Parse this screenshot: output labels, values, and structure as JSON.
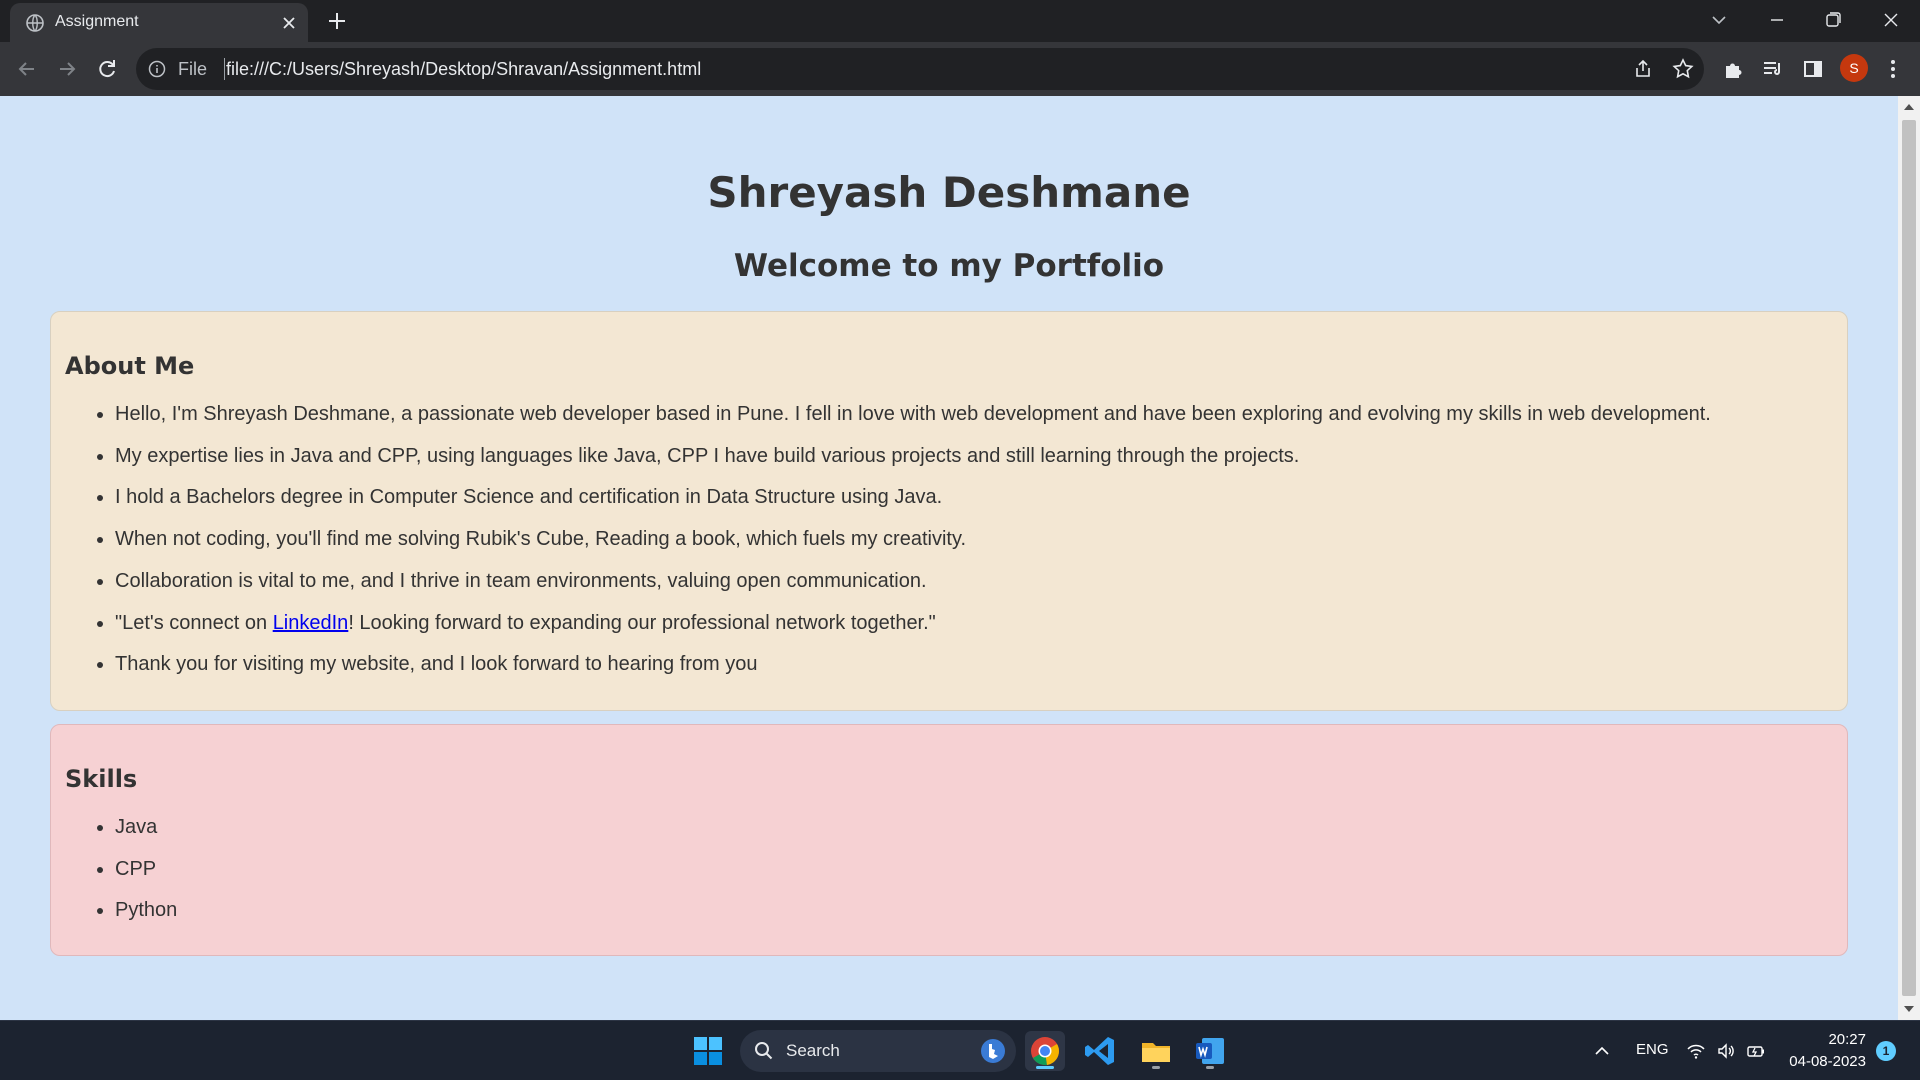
{
  "browser": {
    "tab_title": "Assignment",
    "omnibox": {
      "file_label": "File",
      "url": "file:///C:/Users/Shreyash/Desktop/Shravan/Assignment.html"
    },
    "profile_initial": "S"
  },
  "page": {
    "name": "Shreyash Deshmane",
    "welcome": "Welcome to my Portfolio",
    "about": {
      "heading": "About Me",
      "items": [
        "Hello, I'm Shreyash Deshmane, a passionate web developer based in Pune. I fell in love with web development and have been exploring and evolving my skills in web development.",
        "My expertise lies in Java and CPP, using languages like Java, CPP I have build various projects and still learning through the projects.",
        "I hold a Bachelors degree in Computer Science and certification in Data Structure using Java.",
        "When not coding, you'll find me solving Rubik's Cube, Reading a book, which fuels my creativity.",
        "Collaboration is vital to me, and I thrive in team environments, valuing open communication."
      ],
      "linkedin_item": {
        "before": "\"Let's connect on ",
        "link_text": "LinkedIn",
        "after": "! Looking forward to expanding our professional network together.\""
      },
      "closing_item": "Thank you for visiting my website, and I look forward to hearing from you"
    },
    "skills": {
      "heading": "Skills",
      "items": [
        "Java",
        "CPP",
        "Python"
      ]
    }
  },
  "taskbar": {
    "search_label": "Search",
    "language": "ENG",
    "time": "20:27",
    "date": "04-08-2023",
    "notification_count": "1"
  },
  "colors": {
    "page_background": "#d0e3f8",
    "about_card": "#f3e7d3",
    "skills_card": "#f6d1d3",
    "link": "#0000ee"
  }
}
